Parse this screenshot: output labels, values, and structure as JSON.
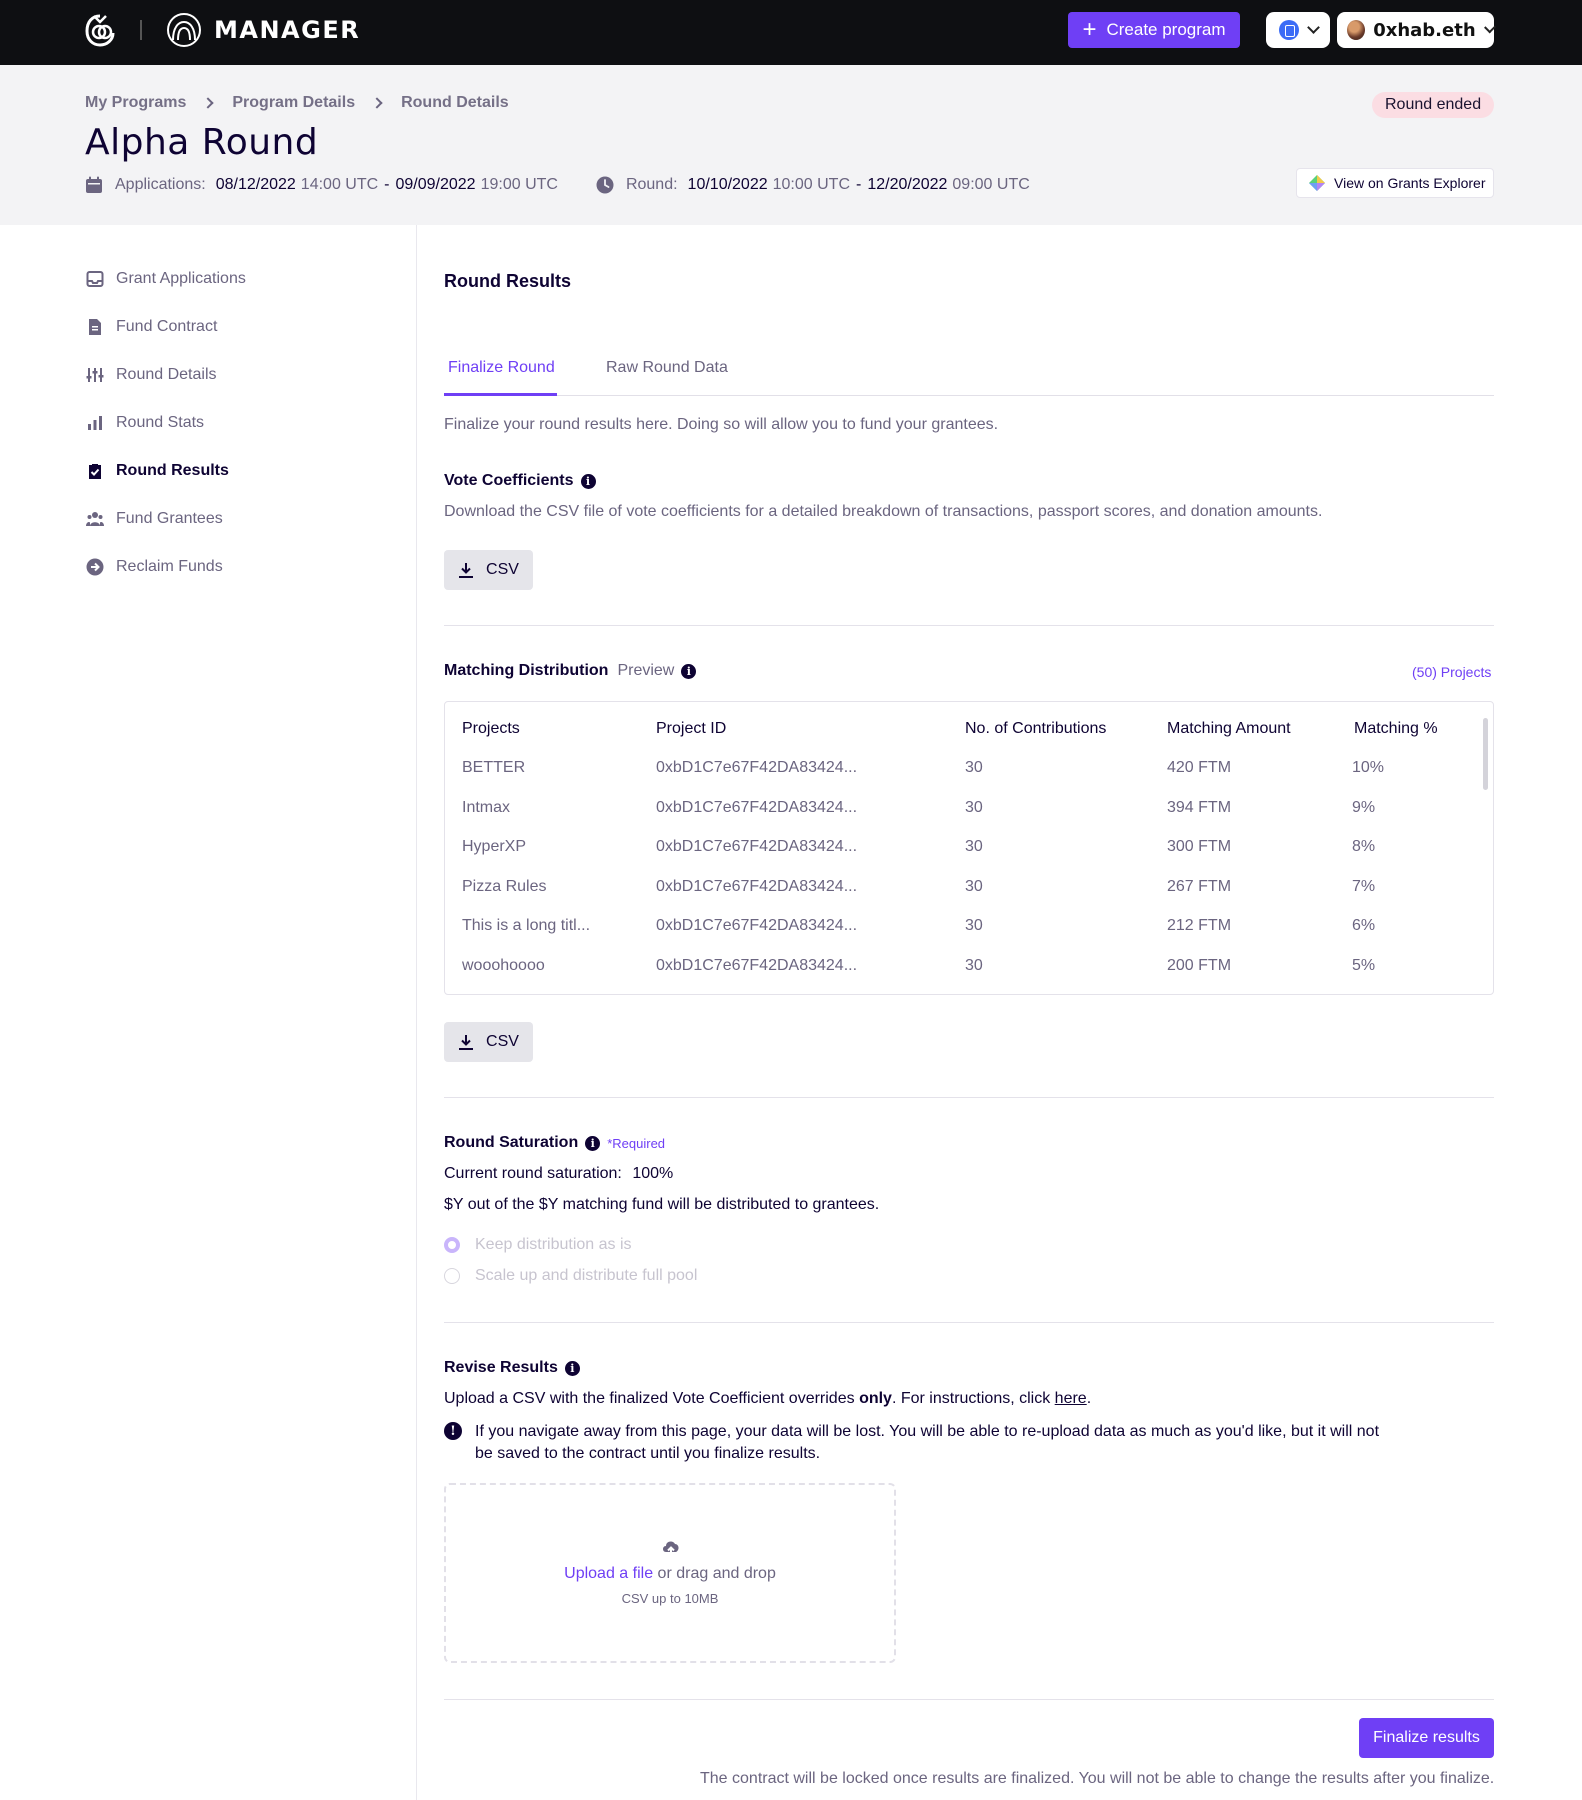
{
  "nav": {
    "app_name": "MANAGER",
    "create_label": "Create program",
    "account": "0xhab.eth"
  },
  "header": {
    "breadcrumb": [
      "My Programs",
      "Program Details",
      "Round Details"
    ],
    "status": "Round ended",
    "title": "Alpha Round",
    "applications_label": "Applications:",
    "app_start_date": "08/12/2022",
    "app_start_time": "14:00 UTC",
    "app_end_date": "09/09/2022",
    "app_end_time": "19:00 UTC",
    "round_label": "Round:",
    "round_start_date": "10/10/2022",
    "round_start_time": "10:00 UTC",
    "round_end_date": "12/20/2022",
    "round_end_time": "09:00 UTC",
    "date_sep": "-",
    "explorer_label": "View on Grants Explorer"
  },
  "sidebar": {
    "items": [
      {
        "label": "Grant Applications",
        "icon": "inbox-icon"
      },
      {
        "label": "Fund Contract",
        "icon": "document-icon"
      },
      {
        "label": "Round Details",
        "icon": "sliders-icon"
      },
      {
        "label": "Round Stats",
        "icon": "bar-chart-icon"
      },
      {
        "label": "Round Results",
        "icon": "clipboard-check-icon",
        "active": true
      },
      {
        "label": "Fund Grantees",
        "icon": "users-icon"
      },
      {
        "label": "Reclaim Funds",
        "icon": "arrow-circle-icon"
      }
    ]
  },
  "main": {
    "title": "Round Results",
    "tabs": [
      "Finalize Round",
      "Raw Round Data"
    ],
    "intro": "Finalize your round results here. Doing so will allow you to fund your grantees.",
    "vote_title": "Vote Coefficients",
    "vote_desc": "Download the CSV file of vote coefficients for a detailed breakdown of transactions, passport scores, and donation amounts.",
    "csv_label": "CSV",
    "matching_title": "Matching Distribution",
    "matching_preview": "Preview",
    "projects_count": "(50) Projects",
    "table": {
      "headers": [
        "Projects",
        "Project ID",
        "No. of Contributions",
        "Matching Amount",
        "Matching %"
      ],
      "rows": [
        [
          "BETTER",
          "0xbD1C7e67F42DA83424...",
          "30",
          "420 FTM",
          "10%"
        ],
        [
          "Intmax",
          "0xbD1C7e67F42DA83424...",
          "30",
          "394 FTM",
          "9%"
        ],
        [
          "HyperXP",
          "0xbD1C7e67F42DA83424...",
          "30",
          "300 FTM",
          "8%"
        ],
        [
          "Pizza Rules",
          "0xbD1C7e67F42DA83424...",
          "30",
          "267 FTM",
          "7%"
        ],
        [
          "This is a long titl...",
          "0xbD1C7e67F42DA83424...",
          "30",
          "212 FTM",
          "6%"
        ],
        [
          "wooohoooo",
          "0xbD1C7e67F42DA83424...",
          "30",
          "200 FTM",
          "5%"
        ]
      ]
    },
    "saturation_title": "Round Saturation",
    "required": "*Required",
    "saturation_label": "Current round saturation:",
    "saturation_value": "100%",
    "saturation_desc": "$Y out of the $Y matching fund will be distributed to grantees.",
    "radio_keep": "Keep distribution as is",
    "radio_scale": "Scale up and distribute full pool",
    "revise_title": "Revise Results",
    "revise_desc_1": "Upload a CSV with the finalized Vote Coefficient overrides",
    "revise_desc_only": "only",
    "revise_desc_2": ". For instructions, click",
    "revise_link": "here",
    "revise_period": ".",
    "warning_1": "If you navigate away from this page, your data will be lost. You will be able to re-upload data as much as you'd like, but it will not",
    "warning_2": "be saved to the contract until you finalize results.",
    "upload_link": "Upload a file",
    "upload_rest": "or drag and drop",
    "upload_hint": "CSV up to 10MB",
    "finalize_label": "Finalize results",
    "footer_note": "The contract will be locked once results are finalized. You will not be able to change the results after you finalize."
  },
  "colors": {
    "accent": "#6f3ff5",
    "nav_bg": "#0e0f12",
    "status_bg": "#fbdde3"
  }
}
